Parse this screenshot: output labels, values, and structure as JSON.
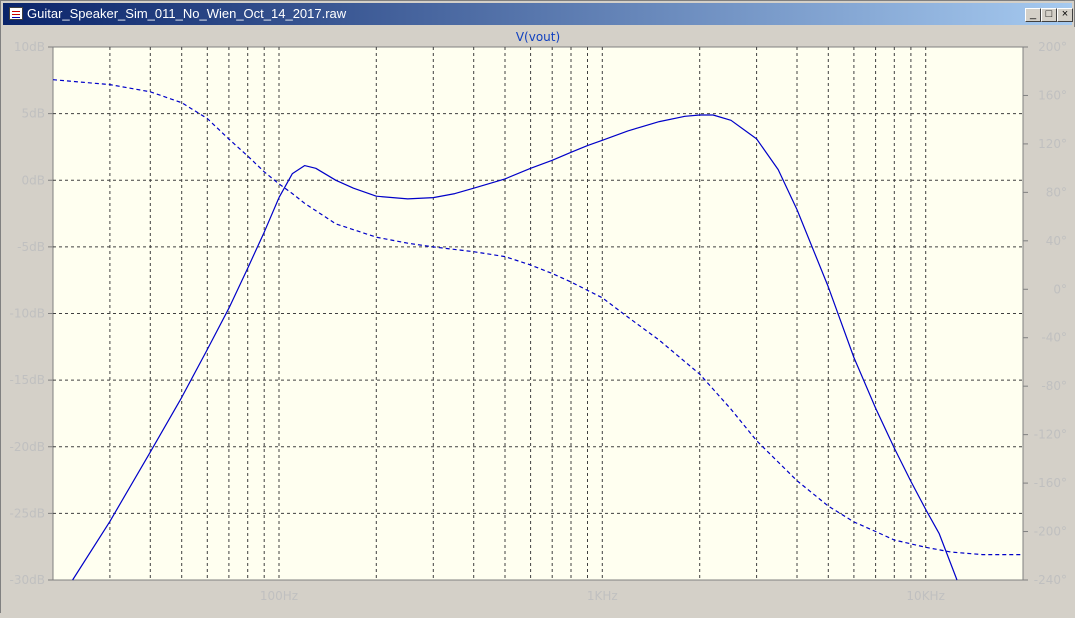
{
  "window": {
    "title": "Guitar_Speaker_Sim_011_No_Wien_Oct_14_2017.raw",
    "buttons": {
      "minimize": "_",
      "maximize": "□",
      "close": "×"
    }
  },
  "colors": {
    "plot_bg": "#fffff0",
    "trace": "#0000c8",
    "grid": "#404040",
    "label": "#c0c0c0",
    "title": "#1040c0"
  },
  "chart_data": {
    "type": "line",
    "title": "V(vout)",
    "x_scale": "log",
    "xlim": [
      20,
      20000
    ],
    "x_ticks": [
      {
        "v": 100,
        "label": "100Hz"
      },
      {
        "v": 1000,
        "label": "1KHz"
      },
      {
        "v": 10000,
        "label": "10KHz"
      }
    ],
    "y_left": {
      "lim": [
        -30,
        10
      ],
      "ticks": [
        {
          "v": 10,
          "label": "10dB"
        },
        {
          "v": 5,
          "label": "5dB"
        },
        {
          "v": 0,
          "label": "0dB"
        },
        {
          "v": -5,
          "label": "-5dB"
        },
        {
          "v": -10,
          "label": "-10dB"
        },
        {
          "v": -15,
          "label": "-15dB"
        },
        {
          "v": -20,
          "label": "-20dB"
        },
        {
          "v": -25,
          "label": "-25dB"
        },
        {
          "v": -30,
          "label": "-30dB"
        }
      ]
    },
    "y_right": {
      "lim": [
        -240,
        200
      ],
      "ticks": [
        {
          "v": 200,
          "label": "200°"
        },
        {
          "v": 160,
          "label": "160°"
        },
        {
          "v": 120,
          "label": "120°"
        },
        {
          "v": 80,
          "label": "80°"
        },
        {
          "v": 40,
          "label": "40°"
        },
        {
          "v": 0,
          "label": "0°"
        },
        {
          "v": -40,
          "label": "-40°"
        },
        {
          "v": -80,
          "label": "-80°"
        },
        {
          "v": -120,
          "label": "-120°"
        },
        {
          "v": -160,
          "label": "-160°"
        },
        {
          "v": -200,
          "label": "-200°"
        },
        {
          "v": -240,
          "label": "-240°"
        }
      ]
    },
    "grid": true,
    "series": [
      {
        "style": "solid",
        "axis": "left",
        "x": [
          23,
          30,
          40,
          50,
          60,
          70,
          80,
          90,
          100,
          110,
          120,
          130,
          150,
          170,
          200,
          250,
          300,
          350,
          400,
          500,
          600,
          700,
          800,
          900,
          1000,
          1200,
          1500,
          1800,
          2000,
          2200,
          2500,
          3000,
          3500,
          4000,
          5000,
          6000,
          7000,
          8000,
          9000,
          10000,
          11000,
          12500
        ],
        "y": [
          -30,
          -25.6,
          -20.4,
          -16.3,
          -12.7,
          -9.6,
          -6.6,
          -3.9,
          -1.3,
          0.5,
          1.1,
          0.9,
          0,
          -0.6,
          -1.2,
          -1.4,
          -1.3,
          -1,
          -0.6,
          0.1,
          0.9,
          1.5,
          2.1,
          2.6,
          3.0,
          3.7,
          4.4,
          4.8,
          4.9,
          4.9,
          4.5,
          3.1,
          0.8,
          -2.2,
          -8,
          -13.3,
          -17.1,
          -20.1,
          -22.6,
          -24.7,
          -26.5,
          -30
        ]
      },
      {
        "style": "dashed",
        "axis": "right",
        "x": [
          20,
          30,
          40,
          50,
          60,
          70,
          80,
          90,
          100,
          110,
          120,
          150,
          200,
          250,
          300,
          400,
          500,
          600,
          700,
          800,
          1000,
          1200,
          1500,
          2000,
          2500,
          3000,
          4000,
          5000,
          6000,
          7000,
          8000,
          10000,
          12000,
          15000,
          20000
        ],
        "y": [
          173,
          169,
          163,
          154,
          141,
          124,
          110,
          97,
          87,
          79,
          71,
          54,
          43,
          38,
          35,
          31,
          27,
          20,
          13,
          6,
          -7,
          -23,
          -42,
          -70,
          -99,
          -125,
          -158,
          -179,
          -192,
          -200,
          -207,
          -213,
          -217,
          -219,
          -219
        ]
      }
    ]
  }
}
